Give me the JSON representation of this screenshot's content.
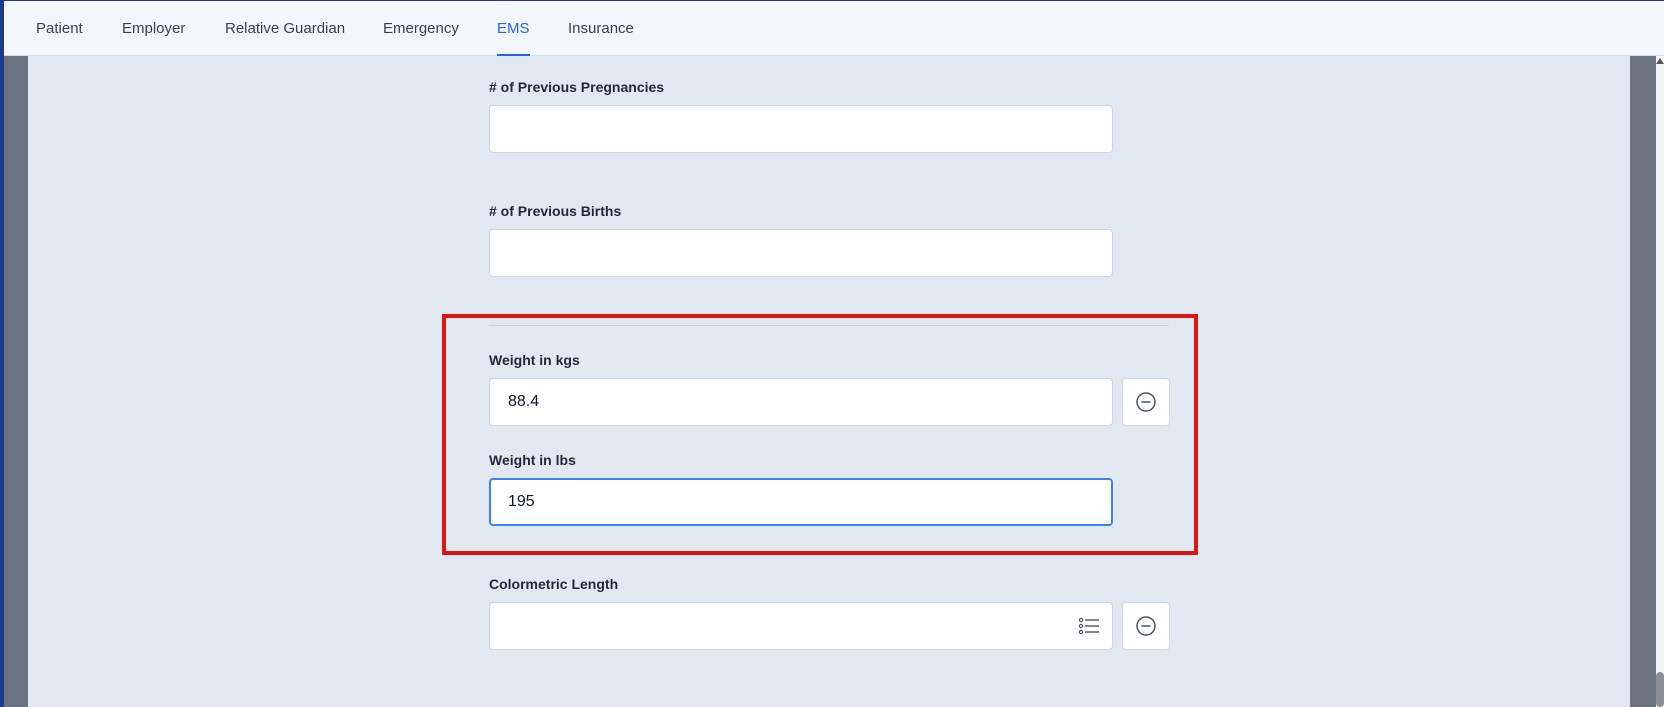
{
  "tabs": [
    {
      "label": "Patient",
      "active": false
    },
    {
      "label": "Employer",
      "active": false
    },
    {
      "label": "Relative Guardian",
      "active": false
    },
    {
      "label": "Emergency",
      "active": false
    },
    {
      "label": "EMS",
      "active": true
    },
    {
      "label": "Insurance",
      "active": false
    }
  ],
  "fields": {
    "previous_pregnancies": {
      "label": "# of Previous Pregnancies",
      "value": ""
    },
    "previous_births": {
      "label": "# of Previous Births",
      "value": ""
    },
    "weight_kgs": {
      "label": "Weight in kgs",
      "value": "88.4"
    },
    "weight_lbs": {
      "label": "Weight in lbs",
      "value": "195"
    },
    "colormetric_length": {
      "label": "Colormetric Length",
      "value": ""
    }
  },
  "icons": {
    "remove": "minus-circle-icon",
    "list": "list-icon"
  },
  "colors": {
    "accent": "#2563eb",
    "highlight": "#dc1414",
    "content_bg": "#e2e8f0"
  }
}
